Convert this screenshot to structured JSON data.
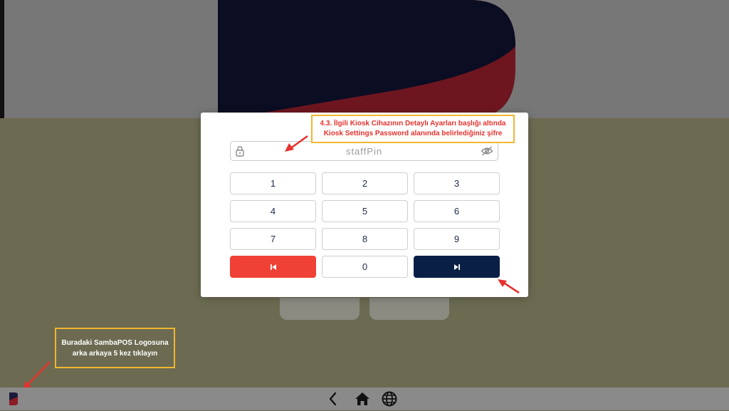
{
  "pin_dialog": {
    "placeholder": "staffPin",
    "keys": [
      "1",
      "2",
      "3",
      "4",
      "5",
      "6",
      "7",
      "8",
      "9",
      "",
      "0",
      ""
    ],
    "back_color": "#ef4135",
    "next_color": "#0a1f44"
  },
  "annotations": {
    "top_line1": "4.3. İlgili Kiosk Cihazının Detaylı Ayarları başlığı altında",
    "top_line2": "Kiosk Settings Password alanında belirlediğiniz şifre",
    "bottom_line1": "Buradaki SambaPOS Logosuna",
    "bottom_line2": "arka arkaya 5 kez tıklayın",
    "highlight_color": "#f1b62f",
    "arrow_color": "#e5322e"
  },
  "icons": {
    "lock": "lock-icon",
    "eye": "eye-off-icon",
    "back": "skip-back-icon",
    "next": "skip-forward-icon",
    "nav_back": "chevron-left-icon",
    "home": "home-icon",
    "language": "globe-icon",
    "logo": "sambapos-logo-icon"
  }
}
